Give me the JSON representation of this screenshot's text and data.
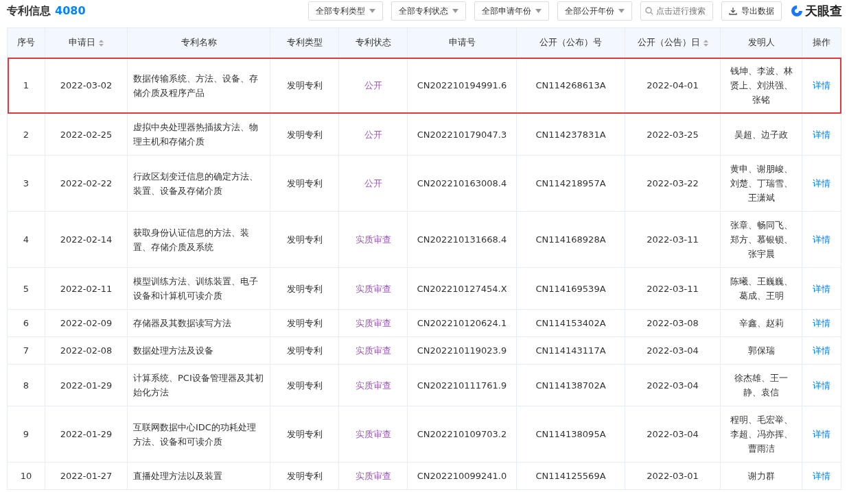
{
  "header": {
    "title": "专利信息",
    "count": "4080",
    "filters": [
      "全部专利类型",
      "全部专利状态",
      "全部申请年份",
      "全部公开年份"
    ],
    "search": {
      "placeholder": "点击进行搜索"
    },
    "export_button": "导出数据",
    "logo": "天眼查"
  },
  "table": {
    "columns": [
      {
        "label": "序号",
        "sortable": false
      },
      {
        "label": "申请日",
        "sortable": true
      },
      {
        "label": "专利名称",
        "sortable": false
      },
      {
        "label": "专利类型",
        "sortable": false
      },
      {
        "label": "专利状态",
        "sortable": false
      },
      {
        "label": "申请号",
        "sortable": false
      },
      {
        "label": "公开（公布）号",
        "sortable": false
      },
      {
        "label": "公开（公告）日",
        "sortable": true
      },
      {
        "label": "发明人",
        "sortable": false
      },
      {
        "label": "操作",
        "sortable": false
      }
    ],
    "rows": [
      {
        "no": "1",
        "date": "2022-03-02",
        "name": "数据传输系统、方法、设备、存储介质及程序产品",
        "type": "发明专利",
        "status": "公开",
        "app_no": "CN202210194991.6",
        "pub_no": "CN114268613A",
        "pub_date": "2022-04-01",
        "inventors": "钱坤、李波、林贤上、刘洪强、张铭",
        "action": "详情",
        "highlighted": true
      },
      {
        "no": "2",
        "date": "2022-02-25",
        "name": "虚拟中央处理器热插拔方法、物理主机和存储介质",
        "type": "发明专利",
        "status": "公开",
        "app_no": "CN202210179047.3",
        "pub_no": "CN114237831A",
        "pub_date": "2022-03-25",
        "inventors": "吴超、边子政",
        "action": "详情",
        "highlighted": false
      },
      {
        "no": "3",
        "date": "2022-02-22",
        "name": "行政区划变迁信息的确定方法、装置、设备及存储介质",
        "type": "发明专利",
        "status": "公开",
        "app_no": "CN202210163008.4",
        "pub_no": "CN114218957A",
        "pub_date": "2022-03-22",
        "inventors": "黄申、谢朋峻、刘楚、丁瑞雪、王潇斌",
        "action": "详情",
        "highlighted": false
      },
      {
        "no": "4",
        "date": "2022-02-14",
        "name": "获取身份认证信息的方法、装置、存储介质及系统",
        "type": "发明专利",
        "status": "实质审查",
        "app_no": "CN202210131668.4",
        "pub_no": "CN114168928A",
        "pub_date": "2022-03-11",
        "inventors": "张章、畅同飞、郑方、慕银锁、张宇晨",
        "action": "详情",
        "highlighted": false
      },
      {
        "no": "5",
        "date": "2022-02-11",
        "name": "模型训练方法、训练装置、电子设备和计算机可读介质",
        "type": "发明专利",
        "status": "实质审查",
        "app_no": "CN202210127454.X",
        "pub_no": "CN114169539A",
        "pub_date": "2022-03-11",
        "inventors": "陈曦、王巍巍、葛成、王明",
        "action": "详情",
        "highlighted": false
      },
      {
        "no": "6",
        "date": "2022-02-09",
        "name": "存储器及其数据读写方法",
        "type": "发明专利",
        "status": "实质审查",
        "app_no": "CN202210120624.1",
        "pub_no": "CN114153402A",
        "pub_date": "2022-03-08",
        "inventors": "辛鑫、赵莉",
        "action": "详情",
        "highlighted": false
      },
      {
        "no": "7",
        "date": "2022-02-08",
        "name": "数据处理方法及设备",
        "type": "发明专利",
        "status": "实质审查",
        "app_no": "CN202210119023.9",
        "pub_no": "CN114143117A",
        "pub_date": "2022-03-04",
        "inventors": "郭保瑞",
        "action": "详情",
        "highlighted": false
      },
      {
        "no": "8",
        "date": "2022-01-29",
        "name": "计算系统、PCI设备管理器及其初始化方法",
        "type": "发明专利",
        "status": "实质审查",
        "app_no": "CN202210111761.9",
        "pub_no": "CN114138702A",
        "pub_date": "2022-03-04",
        "inventors": "徐杰雄、王一静、袁信",
        "action": "详情",
        "highlighted": false
      },
      {
        "no": "9",
        "date": "2022-01-29",
        "name": "互联网数据中心IDC的功耗处理方法、设备和可读介质",
        "type": "发明专利",
        "status": "实质审查",
        "app_no": "CN202210109703.2",
        "pub_no": "CN114138095A",
        "pub_date": "2022-03-04",
        "inventors": "程明、毛宏举、李超、冯亦挥、曹雨洁",
        "action": "详情",
        "highlighted": false
      },
      {
        "no": "10",
        "date": "2022-01-27",
        "name": "直播处理方法以及装置",
        "type": "发明专利",
        "status": "实质审查",
        "app_no": "CN202210099241.0",
        "pub_no": "CN114125569A",
        "pub_date": "2022-03-01",
        "inventors": "谢力群",
        "action": "详情",
        "highlighted": false
      }
    ]
  }
}
